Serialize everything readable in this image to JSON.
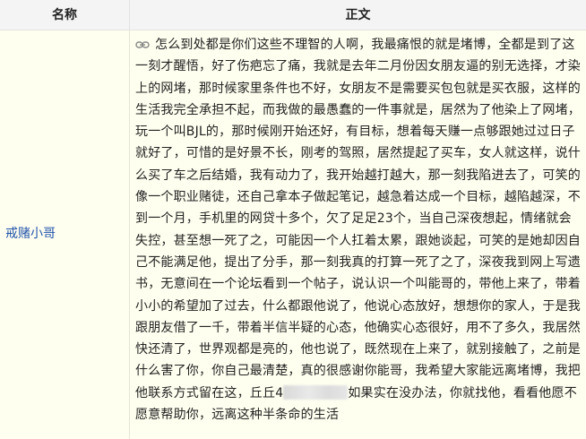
{
  "table": {
    "headers": {
      "name": "名称",
      "body": "正文"
    },
    "rows": [
      {
        "name": "戒赌小哥",
        "icon": "link-icon",
        "body_part1": "怎么到处都是你们这些不理智的人啊，我最痛恨的就是堵博，全都是到了这一刻才醒悟，好了伤疤忘了痛，我就是去年二月份因女朋友逼的别无选择，才染上的网堵，那时候家里条件也不好，女朋友不是需要买包包就是买衣服，这样的生活我完全承担不起，而我做的最愚蠢的一件事就是，居然为了他染上了网堵，玩一个叫BJL的，那时候刚开始还好，有目标，想着每天赚一点够跟她过过日子就好了，可惜的是好景不长，刚考的驾照，居然提起了买车，女人就这样，说什么买了车之后结婚，我有动力了，我开始越打越大，那一刻我陷进去了，可笑的像一个职业赌徒，还自己拿本子做起笔记，越急着达成一个目标，越陷越深，不到一个月，手机里的网贷十多个，欠了足足23个，当自己深夜想起，情绪就会失控，甚至想一死了之，可能因一个人扛着太累，跟她谈起，可笑的是她却因自己不能满足他，提出了分手，那一刻我真的打算一死了之了，深夜我到网上写遗书，无意间在一个论坛看到一个帖子，说认识一个叫能哥的，带他上来了，带着小小的希望加了过去，什么都跟他说了，他说心态放好，想想你的家人，于是我跟朋友借了一千，带着半信半疑的心态，他确实心态很好，用不了多久，我居然快还清了，世界观都是亮的，他也说了，既然现在上来了，就别接触了，之前是什么害了你，你自己最清楚，真的很感谢你能哥，我希望大家能远离堵博，我把他联系方式留在这，丘丘4",
        "body_part2": "如果实在没办法，你就找他，看看他愿不愿意帮助你，远离这种半条命的生活"
      }
    ]
  }
}
